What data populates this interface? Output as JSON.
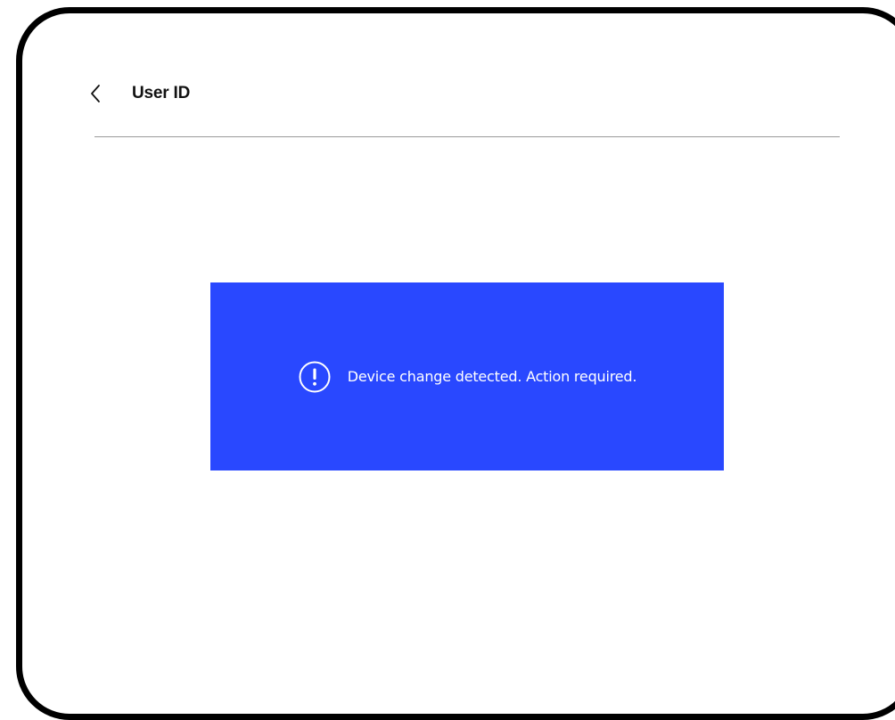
{
  "header": {
    "back_icon": "chevron-left-icon",
    "title": "User ID"
  },
  "alert": {
    "icon": "exclamation-circle-icon",
    "message": "Device change detected. Action required.",
    "background_color": "#2948ff",
    "text_color": "#ffffff"
  },
  "colors": {
    "frame": "#000000",
    "background": "#ffffff",
    "divider": "#9a9a9a"
  }
}
